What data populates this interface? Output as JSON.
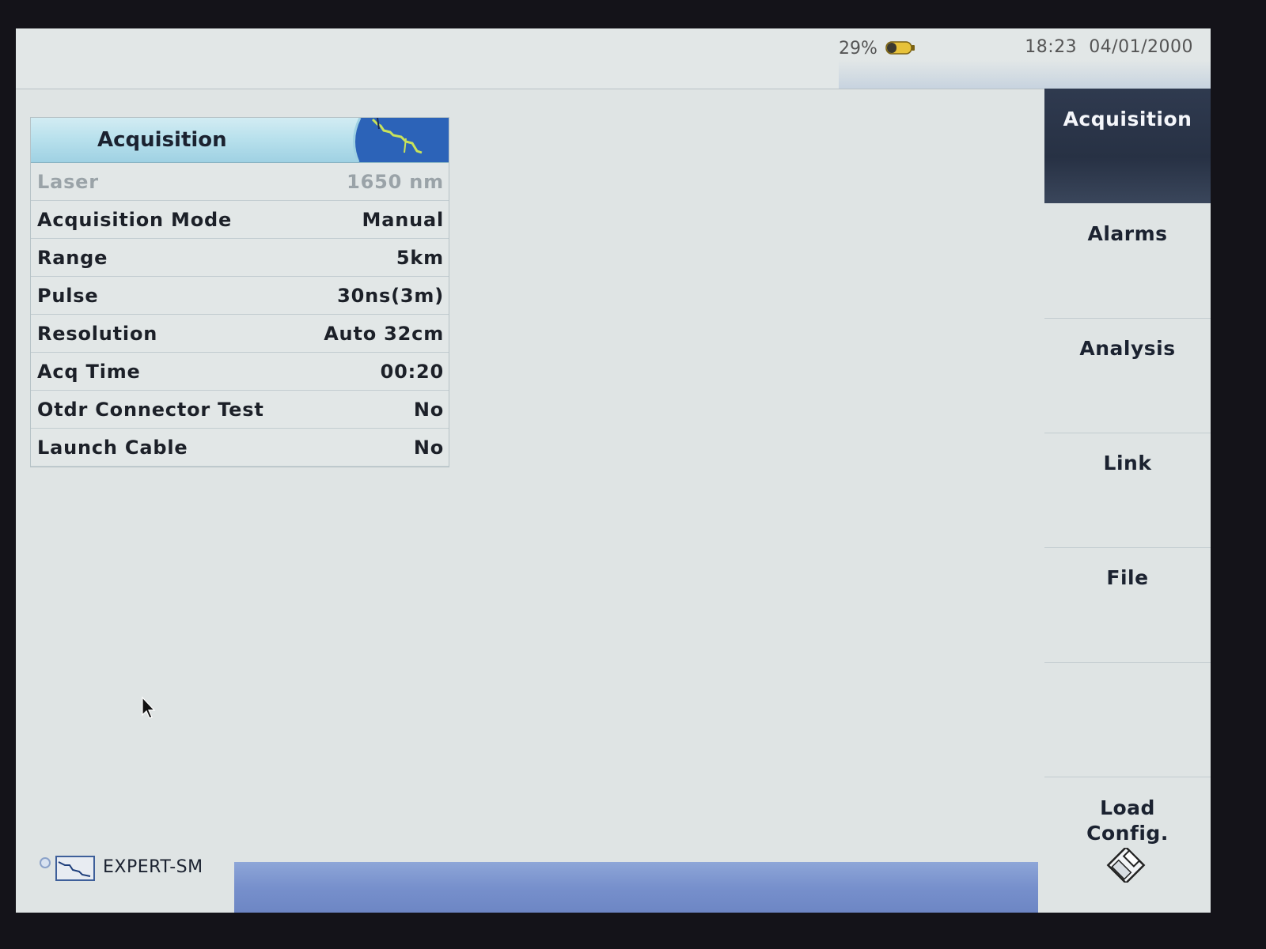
{
  "status": {
    "battery_percent": "29%",
    "time": "18:23",
    "date": "04/01/2000"
  },
  "panel": {
    "title": "Acquisition",
    "rows": [
      {
        "label": "Laser",
        "value": "1650 nm",
        "enabled": false
      },
      {
        "label": "Acquisition Mode",
        "value": "Manual",
        "enabled": true
      },
      {
        "label": "Range",
        "value": "5km",
        "enabled": true
      },
      {
        "label": "Pulse",
        "value": "30ns(3m)",
        "enabled": true
      },
      {
        "label": "Resolution",
        "value": "Auto 32cm",
        "enabled": true
      },
      {
        "label": "Acq Time",
        "value": "00:20",
        "enabled": true
      },
      {
        "label": "Otdr Connector Test",
        "value": "No",
        "enabled": true
      },
      {
        "label": "Launch Cable",
        "value": "No",
        "enabled": true
      }
    ]
  },
  "menu": {
    "items": [
      {
        "label": "Acquisition",
        "active": true
      },
      {
        "label": "Alarms",
        "active": false
      },
      {
        "label": "Analysis",
        "active": false
      },
      {
        "label": "Link",
        "active": false
      },
      {
        "label": "File",
        "active": false
      },
      {
        "label": "",
        "active": false
      }
    ],
    "load_config": {
      "label": "Load\nConfig.",
      "icon": "diskette-icon"
    }
  },
  "footer": {
    "mode_label": "EXPERT-SM",
    "mode_icon": "otdr-trace-icon"
  },
  "colors": {
    "active_menu": "#2f3a4f",
    "panel_header": "#b7e0ec",
    "bottom_bar": "#7790cc"
  }
}
